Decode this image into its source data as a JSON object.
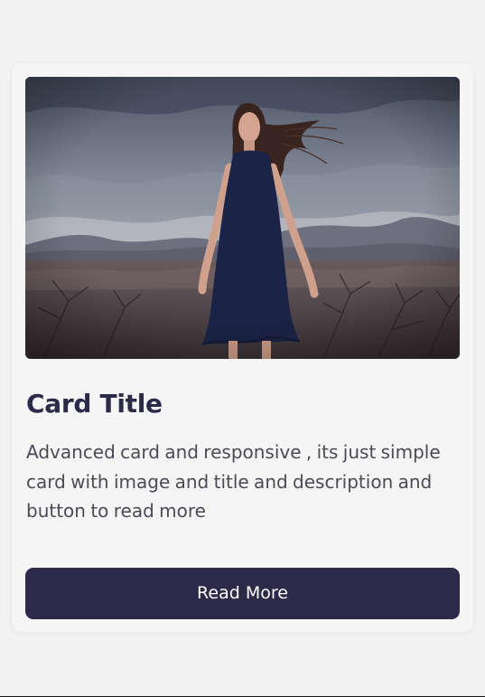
{
  "card": {
    "title": "Card Title",
    "description": "Advanced card and responsive , its just simple card with image and title and description and button to read more",
    "button_label": "Read More"
  },
  "image": {
    "semantic": "photo of a woman in a dark dress standing in a desert with mountains and a cloudy sky"
  },
  "colors": {
    "page_bg": "#f2f2f2",
    "card_bg": "#f5f5f5",
    "title_text": "#2b2a49",
    "body_text": "#4b4b55",
    "button_bg": "#2c2a48",
    "button_text": "#ffffff"
  }
}
